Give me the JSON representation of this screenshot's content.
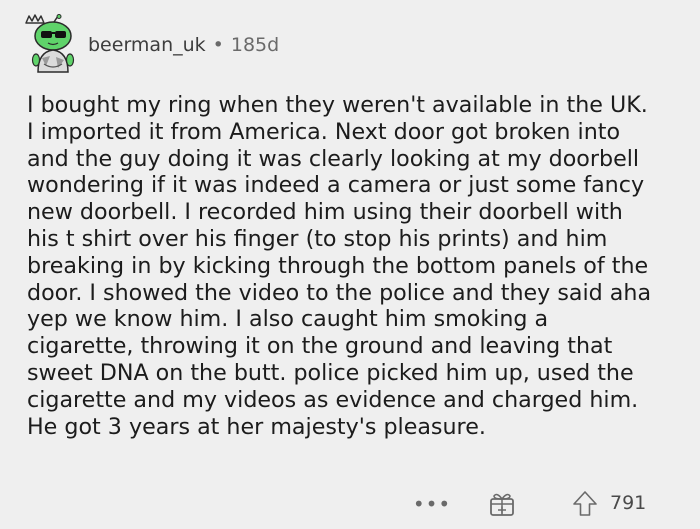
{
  "comment": {
    "username": "beerman_uk",
    "separator": "•",
    "age": "185d",
    "lines": [
      "I bought my ring when they weren't available in the UK.",
      "I imported it from America. Next door got broken into",
      "and the guy doing it was clearly looking at my doorbell",
      "wondering if it was indeed a camera or just some fancy",
      "new doorbell. I recorded him using their doorbell with",
      "his t shirt over his finger (to stop his prints) and him",
      "breaking in by kicking through the bottom panels of the",
      "door. I showed the video to the police and they said aha",
      "yep we know him. I also caught him smoking a",
      "cigarette, throwing it on the ground and leaving that",
      "sweet DNA on the butt. police picked him up, used the",
      "cigarette and my videos as evidence and charged him.",
      "He got 3 years at her majesty's pleasure."
    ],
    "score": "791",
    "more_label": "•••"
  },
  "icons": {
    "avatar": "snoo-avatar-icon",
    "award": "gift-award-icon",
    "upvote": "upvote-arrow-icon",
    "more": "more-options-icon"
  },
  "colors": {
    "background": "#efefef",
    "avatar_green": "#5fd36a",
    "text": "#1c1c1c",
    "muted": "#6a6a6a"
  }
}
